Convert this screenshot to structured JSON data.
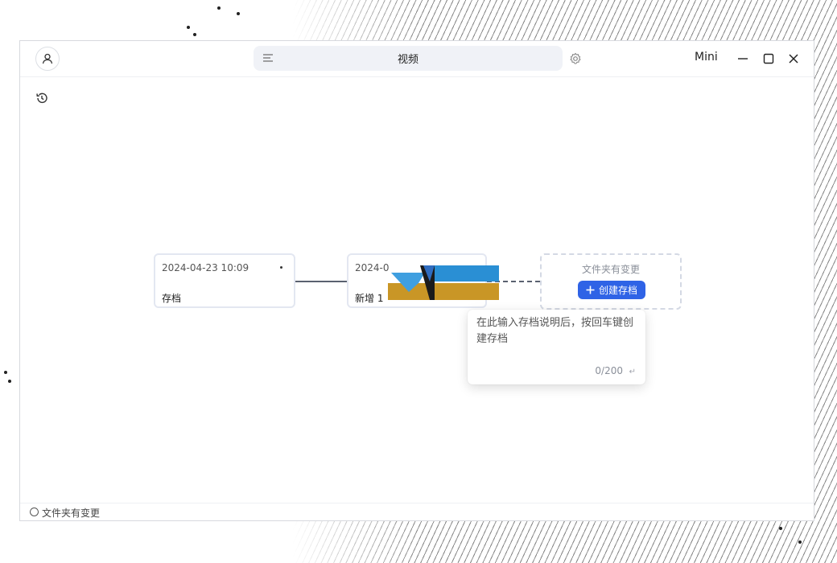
{
  "window": {
    "title": "视频",
    "mini_label": "Mini"
  },
  "timeline": {
    "cards": [
      {
        "date": "2024-04-23 10:09",
        "label": "存档"
      },
      {
        "date": "2024-0",
        "label": "新增 1"
      }
    ],
    "pending": {
      "status": "文件夹有变更",
      "create_button": "创建存档"
    }
  },
  "popover": {
    "placeholder": "在此输入存档说明后，按回车键创建存档",
    "counter": "0/200",
    "enter_glyph": "↵"
  },
  "statusbar": {
    "text": "文件夹有变更"
  },
  "colors": {
    "accent": "#2f63e6",
    "logo_blue": "#2a8fd4",
    "logo_gold": "#c99626"
  },
  "icons": [
    "user-icon",
    "menu-icon",
    "gear-icon",
    "minimize-icon",
    "maximize-icon",
    "close-icon",
    "history-icon",
    "plus-icon",
    "enter-icon",
    "status-circle-icon"
  ]
}
